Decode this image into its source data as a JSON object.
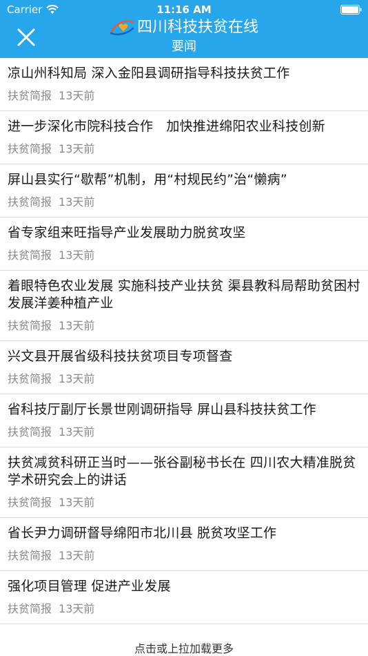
{
  "status_bar": {
    "carrier": "Carrier",
    "time": "11:16 AM"
  },
  "header": {
    "app_title": "四川科技扶贫在线",
    "subtitle": "要闻",
    "background_color": "#27a6ec",
    "close_icon": "close-icon",
    "logo_icon": "kj-logo-icon"
  },
  "news": [
    {
      "title": "凉山州科知局 深入金阳县调研指导科技扶贫工作",
      "source": "扶贫简报",
      "time": "13天前"
    },
    {
      "title": "进一步深化市院科技合作　加快推进绵阳农业科技创新",
      "source": "扶贫简报",
      "time": "13天前"
    },
    {
      "title": "屏山县实行“歇帮”机制，用“村规民约”治“懒病”",
      "source": "扶贫简报",
      "time": "13天前"
    },
    {
      "title": "省专家组来旺指导产业发展助力脱贫攻坚",
      "source": "扶贫简报",
      "time": "13天前"
    },
    {
      "title": "着眼特色农业发展 实施科技产业扶贫 渠县教科局帮助贫困村发展洋姜种植产业",
      "source": "扶贫简报",
      "time": "13天前"
    },
    {
      "title": "兴文县开展省级科技扶贫项目专项督查",
      "source": "扶贫简报",
      "time": "13天前"
    },
    {
      "title": "省科技厅副厅长景世刚调研指导 屏山县科技扶贫工作",
      "source": "扶贫简报",
      "time": "13天前"
    },
    {
      "title": "扶贫减贫科研正当时——张谷副秘书长在 四川农大精准脱贫学术研究会上的讲话",
      "source": "扶贫简报",
      "time": "13天前"
    },
    {
      "title": "省长尹力调研督导绵阳市北川县 脱贫攻坚工作",
      "source": "扶贫简报",
      "time": "13天前"
    },
    {
      "title": "强化项目管理 促进产业发展",
      "source": "扶贫简报",
      "time": "13天前"
    }
  ],
  "load_more": "点击或上拉加载更多"
}
